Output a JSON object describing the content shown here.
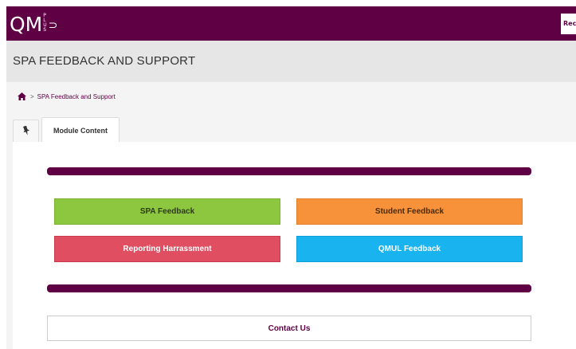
{
  "header": {
    "logo_text": "QM",
    "logo_sub": [
      "P",
      "L",
      "U",
      "S"
    ],
    "login_label": "Rec"
  },
  "page": {
    "title": "SPA FEEDBACK AND SUPPORT"
  },
  "breadcrumb": {
    "home_icon": "home-icon",
    "separator": ">",
    "current": "SPA Feedback and Support"
  },
  "tabs": [
    {
      "icon": "pin-icon"
    },
    {
      "label": "Module Content"
    }
  ],
  "buttons": {
    "spa_feedback": "SPA Feedback",
    "student_feedback": "Student Feedback",
    "reporting_harassment": "Reporting Harrassment",
    "qmul_feedback": "QMUL Feedback",
    "contact_us": "Contact Us"
  },
  "colors": {
    "brand": "#5f0044",
    "spa_feedback": "#8dc63f",
    "student_feedback": "#f7923a",
    "reporting_harassment": "#e04e61",
    "qmul_feedback": "#19b3ef"
  }
}
